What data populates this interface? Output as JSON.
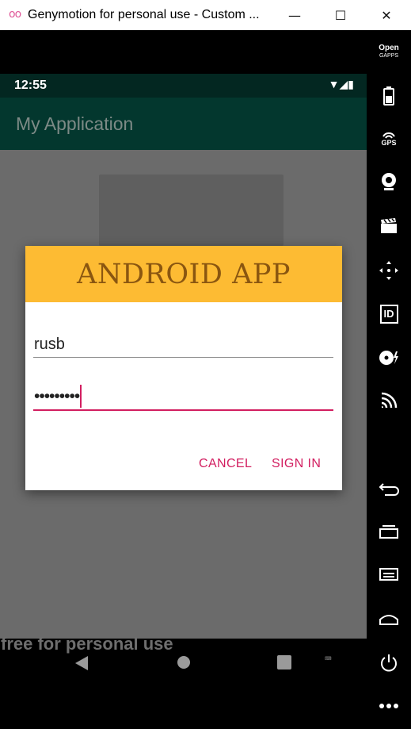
{
  "window": {
    "title": "Genymotion for personal use - Custom ...",
    "minimize_glyph": "—",
    "maximize_glyph": "☐",
    "close_glyph": "✕"
  },
  "statusbar": {
    "time": "12:55",
    "icons": "▼◢▮"
  },
  "app": {
    "title": "My Application"
  },
  "dialog": {
    "title": "ANDROID APP",
    "username_value": "rusb",
    "password_value": "•••••••••",
    "cancel_label": "CANCEL",
    "signin_label": "SIGN IN"
  },
  "watermark": "free for personal use",
  "sidebar": {
    "open_gapps_line1": "Open",
    "open_gapps_line2": "GAPPS",
    "gps_label": "GPS",
    "id_label": "ID"
  },
  "icons": {
    "window_logo": "oo",
    "battery": "battery-icon",
    "gps": "gps-icon",
    "camera": "webcam-icon",
    "media": "clapperboard-icon",
    "dpad": "dpad-icon",
    "id": "device-id-icon",
    "disk": "disk-icon",
    "cast": "cast-icon",
    "back": "back-icon",
    "recent": "recent-apps-icon",
    "menu": "menu-icon",
    "home": "home-icon",
    "power": "power-icon",
    "more": "more-icon"
  },
  "colors": {
    "statusbar": "#032721",
    "appbar": "#03372e",
    "dialog_header": "#fdbb33",
    "accent": "#d21e60",
    "dialog_title": "#8a5610"
  }
}
